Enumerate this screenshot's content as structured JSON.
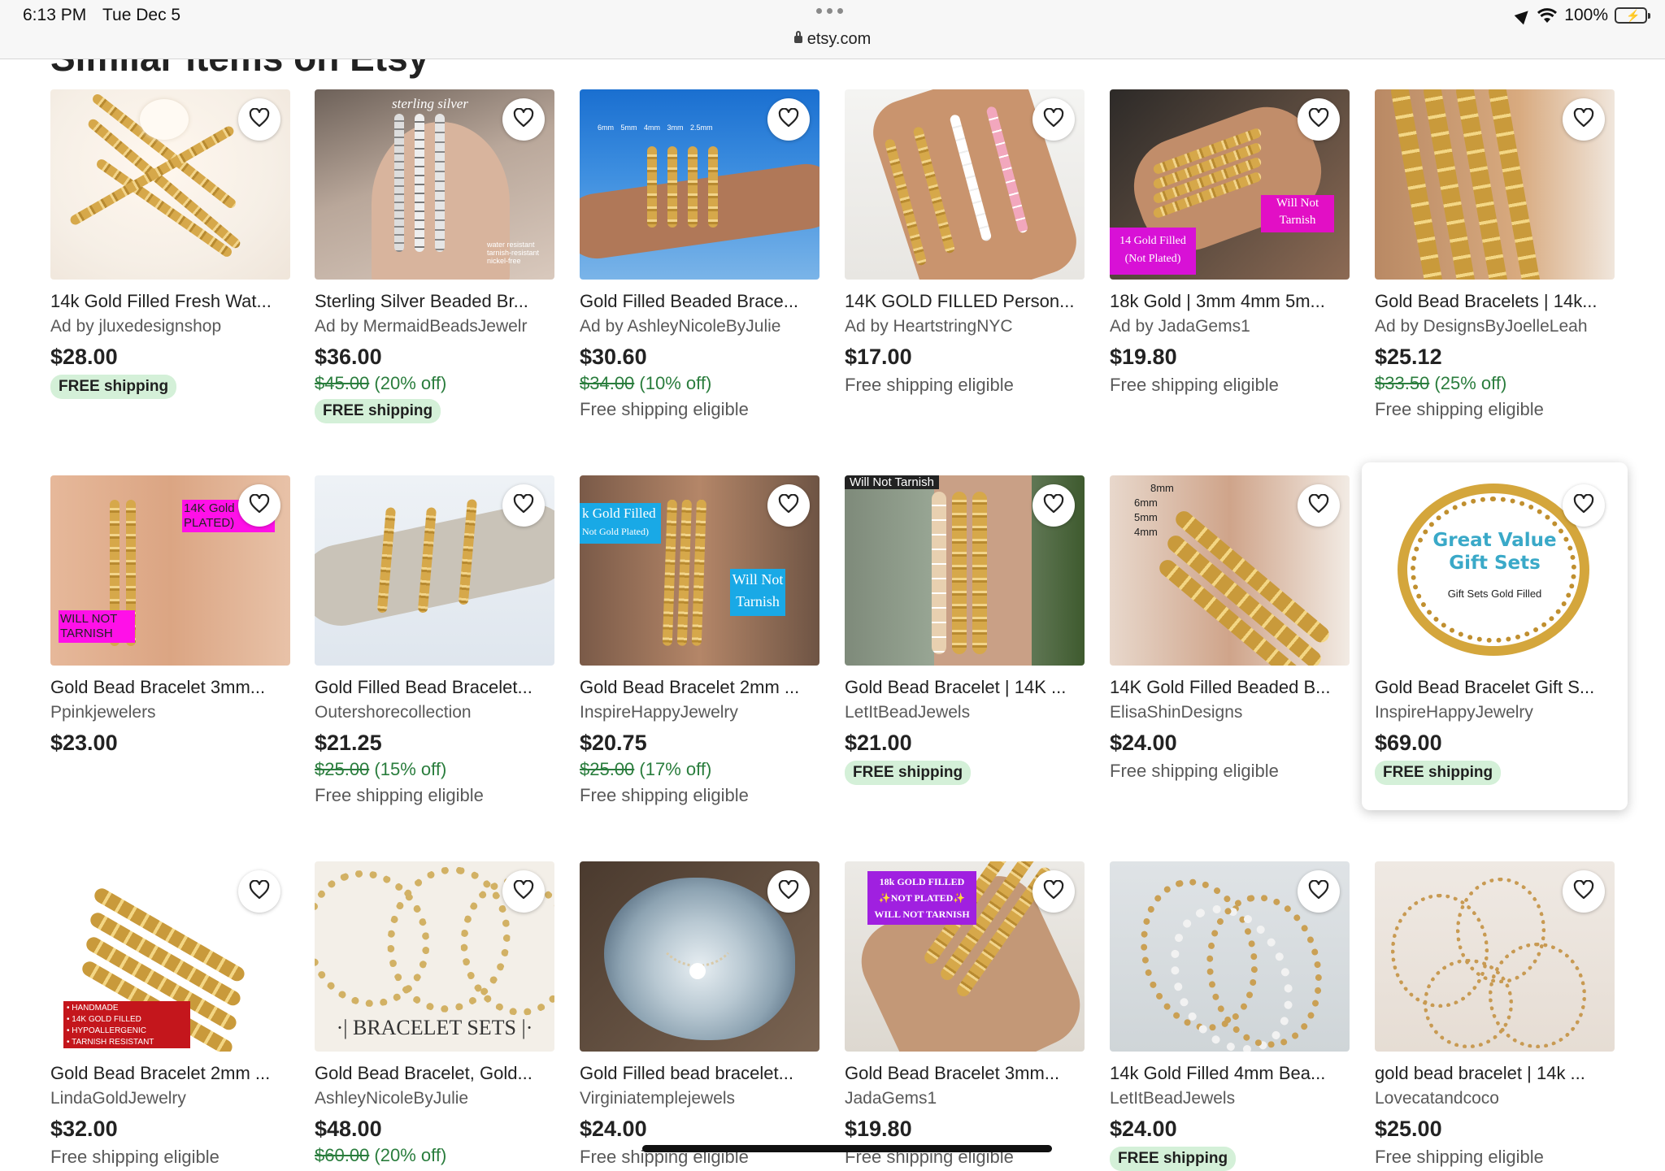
{
  "status_bar": {
    "time": "6:13 PM",
    "date": "Tue Dec 5",
    "url": "etsy.com",
    "battery": "100%"
  },
  "page": {
    "section_heading": "Similar items on Etsy"
  },
  "colors": {
    "badge_bg": "#d4f0d8",
    "discount_text": "#2a7d3d"
  },
  "icons": {
    "favorite": "heart-outline-icon"
  },
  "listings": [
    {
      "title": "14k Gold Filled Fresh Wat...",
      "shop": "Ad by jluxedesignshop",
      "price": "$28.00",
      "original_price": "",
      "discount": "",
      "shipping_badge": "FREE shipping",
      "shipping_text": ""
    },
    {
      "title": "Sterling Silver Beaded Br...",
      "shop": "Ad by MermaidBeadsJewelr",
      "price": "$36.00",
      "original_price": "$45.00",
      "discount": "(20% off)",
      "shipping_badge": "FREE shipping",
      "shipping_text": ""
    },
    {
      "title": "Gold Filled Beaded Brace...",
      "shop": "Ad by AshleyNicoleByJulie",
      "price": "$30.60",
      "original_price": "$34.00",
      "discount": "(10% off)",
      "shipping_badge": "",
      "shipping_text": "Free shipping eligible"
    },
    {
      "title": "14K GOLD FILLED Person...",
      "shop": "Ad by HeartstringNYC",
      "price": "$17.00",
      "original_price": "",
      "discount": "",
      "shipping_badge": "",
      "shipping_text": "Free shipping eligible"
    },
    {
      "title": "18k Gold | 3mm 4mm 5m...",
      "shop": "Ad by JadaGems1",
      "price": "$19.80",
      "original_price": "",
      "discount": "",
      "shipping_badge": "",
      "shipping_text": "Free shipping eligible"
    },
    {
      "title": "Gold Bead Bracelets | 14k...",
      "shop": "Ad by DesignsByJoelleLeah",
      "price": "$25.12",
      "original_price": "$33.50",
      "discount": "(25% off)",
      "shipping_badge": "",
      "shipping_text": "Free shipping eligible"
    },
    {
      "title": "Gold Bead Bracelet 3mm...",
      "shop": "Ppinkjewelers",
      "price": "$23.00",
      "original_price": "",
      "discount": "",
      "shipping_badge": "",
      "shipping_text": ""
    },
    {
      "title": "Gold Filled Bead Bracelet...",
      "shop": "Outershorecollection",
      "price": "$21.25",
      "original_price": "$25.00",
      "discount": "(15% off)",
      "shipping_badge": "",
      "shipping_text": "Free shipping eligible"
    },
    {
      "title": "Gold Bead Bracelet 2mm ...",
      "shop": "InspireHappyJewelry",
      "price": "$20.75",
      "original_price": "$25.00",
      "discount": "(17% off)",
      "shipping_badge": "",
      "shipping_text": "Free shipping eligible"
    },
    {
      "title": "Gold Bead Bracelet | 14K ...",
      "shop": "LetItBeadJewels",
      "price": "$21.00",
      "original_price": "",
      "discount": "",
      "shipping_badge": "FREE shipping",
      "shipping_text": ""
    },
    {
      "title": "14K Gold Filled Beaded B...",
      "shop": "ElisaShinDesigns",
      "price": "$24.00",
      "original_price": "",
      "discount": "",
      "shipping_badge": "",
      "shipping_text": "Free shipping eligible"
    },
    {
      "title": "Gold Bead Bracelet Gift S...",
      "shop": "InspireHappyJewelry",
      "price": "$69.00",
      "original_price": "",
      "discount": "",
      "shipping_badge": "FREE shipping",
      "shipping_text": ""
    },
    {
      "title": "Gold Bead Bracelet 2mm ...",
      "shop": "LindaGoldJewelry",
      "price": "$32.00",
      "original_price": "",
      "discount": "",
      "shipping_badge": "",
      "shipping_text": "Free shipping eligible"
    },
    {
      "title": "Gold Bead Bracelet, Gold...",
      "shop": "AshleyNicoleByJulie",
      "price": "$48.00",
      "original_price": "$60.00",
      "discount": "(20% off)",
      "shipping_badge": "",
      "shipping_text": ""
    },
    {
      "title": "Gold Filled bead bracelet...",
      "shop": "Virginiatemplejewels",
      "price": "$24.00",
      "original_price": "",
      "discount": "",
      "shipping_badge": "",
      "shipping_text": "Free shipping eligible"
    },
    {
      "title": "Gold Bead Bracelet 3mm...",
      "shop": "JadaGems1",
      "price": "$19.80",
      "original_price": "",
      "discount": "",
      "shipping_badge": "",
      "shipping_text": "Free shipping eligible"
    },
    {
      "title": "14k Gold Filled 4mm Bea...",
      "shop": "LetItBeadJewels",
      "price": "$24.00",
      "original_price": "",
      "discount": "",
      "shipping_badge": "FREE shipping",
      "shipping_text": ""
    },
    {
      "title": "gold bead bracelet | 14k ...",
      "shop": "Lovecatandcoco",
      "price": "$25.00",
      "original_price": "",
      "discount": "",
      "shipping_badge": "",
      "shipping_text": "Free shipping eligible"
    }
  ],
  "image_overlays": {
    "sterling": "sterling silver",
    "sterling_note": "water resistant tarnish-resistant nickel-free",
    "sizes": "6mm 5mm 4mm 3mm 2.5mm",
    "will_not_tarnish": "Will Not Tarnish",
    "gold_filled_not_plated": "14 Gold Filled (Not Plated)",
    "pink_14k": "14K Gold (NOT PLATED)",
    "pink_will_not": "WILL NOT TARNISH",
    "gold_filled_tag": "k Gold Filled",
    "not_gold_plated": "Not Gold Plated)",
    "will_not_tarnish_top": "Will Not Tarnish",
    "mm_8": "8mm",
    "mm_6": "6mm",
    "mm_5": "5mm",
    "mm_4": "4mm",
    "great_value": "Great Value",
    "gift_sets": "Gift Sets",
    "gift_sets_sub": "Gift Sets Gold Filled",
    "handmade_list": "• HANDMADE\n• 14K GOLD FILLED\n• HYPOALLERGENIC\n• TARNISH RESISTANT",
    "bracelet_sets": "·| BRACELET SETS |·",
    "purple_tag": "18k GOLD FILLED ✨NOT PLATED✨ WILL NOT TARNISH"
  }
}
